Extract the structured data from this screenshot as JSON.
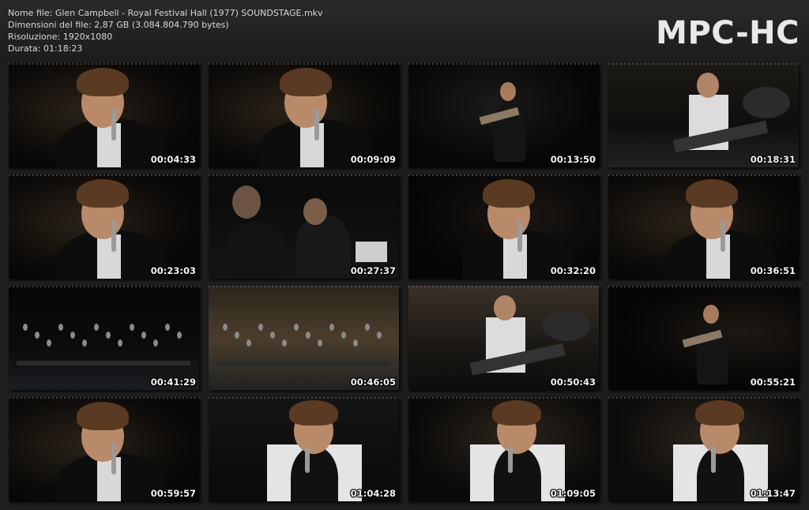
{
  "info": {
    "filename": "Nome file: Glen Campbell - Royal Festival Hall (1977) SOUNDSTAGE.mkv",
    "filesize": "Dimensioni del file: 2,87 GB (3.084.804.790 bytes)",
    "resolution": "Risoluzione: 1920x1080",
    "duration": "Durata: 01:18:23"
  },
  "logo": "MPC-HC",
  "thumbnails": [
    {
      "timestamp": "00:04:33",
      "scene": "closeup-singing-mic"
    },
    {
      "timestamp": "00:09:09",
      "scene": "closeup-singing-mic"
    },
    {
      "timestamp": "00:13:50",
      "scene": "stage-guitar-wide"
    },
    {
      "timestamp": "00:18:31",
      "scene": "electric-guitar-band"
    },
    {
      "timestamp": "00:23:03",
      "scene": "closeup-singing-mic"
    },
    {
      "timestamp": "00:27:37",
      "scene": "conductor-sheet-music"
    },
    {
      "timestamp": "00:32:20",
      "scene": "singing-holding-mic"
    },
    {
      "timestamp": "00:36:51",
      "scene": "closeup-singing-mic"
    },
    {
      "timestamp": "00:41:29",
      "scene": "orchestra-wide"
    },
    {
      "timestamp": "00:46:05",
      "scene": "orchestra-overhead"
    },
    {
      "timestamp": "00:50:43",
      "scene": "stage-guitar-band"
    },
    {
      "timestamp": "00:55:21",
      "scene": "acoustic-guitar-mic"
    },
    {
      "timestamp": "00:59:57",
      "scene": "closeup-singing-mic"
    },
    {
      "timestamp": "01:04:28",
      "scene": "singing-vest-band"
    },
    {
      "timestamp": "01:09:05",
      "scene": "singing-vest-closeup"
    },
    {
      "timestamp": "01:13:47",
      "scene": "singing-vest-gesture"
    }
  ],
  "colors": {
    "background": "#1e1e1e",
    "text": "#d8d8d8",
    "logo": "#e8e8e8"
  }
}
